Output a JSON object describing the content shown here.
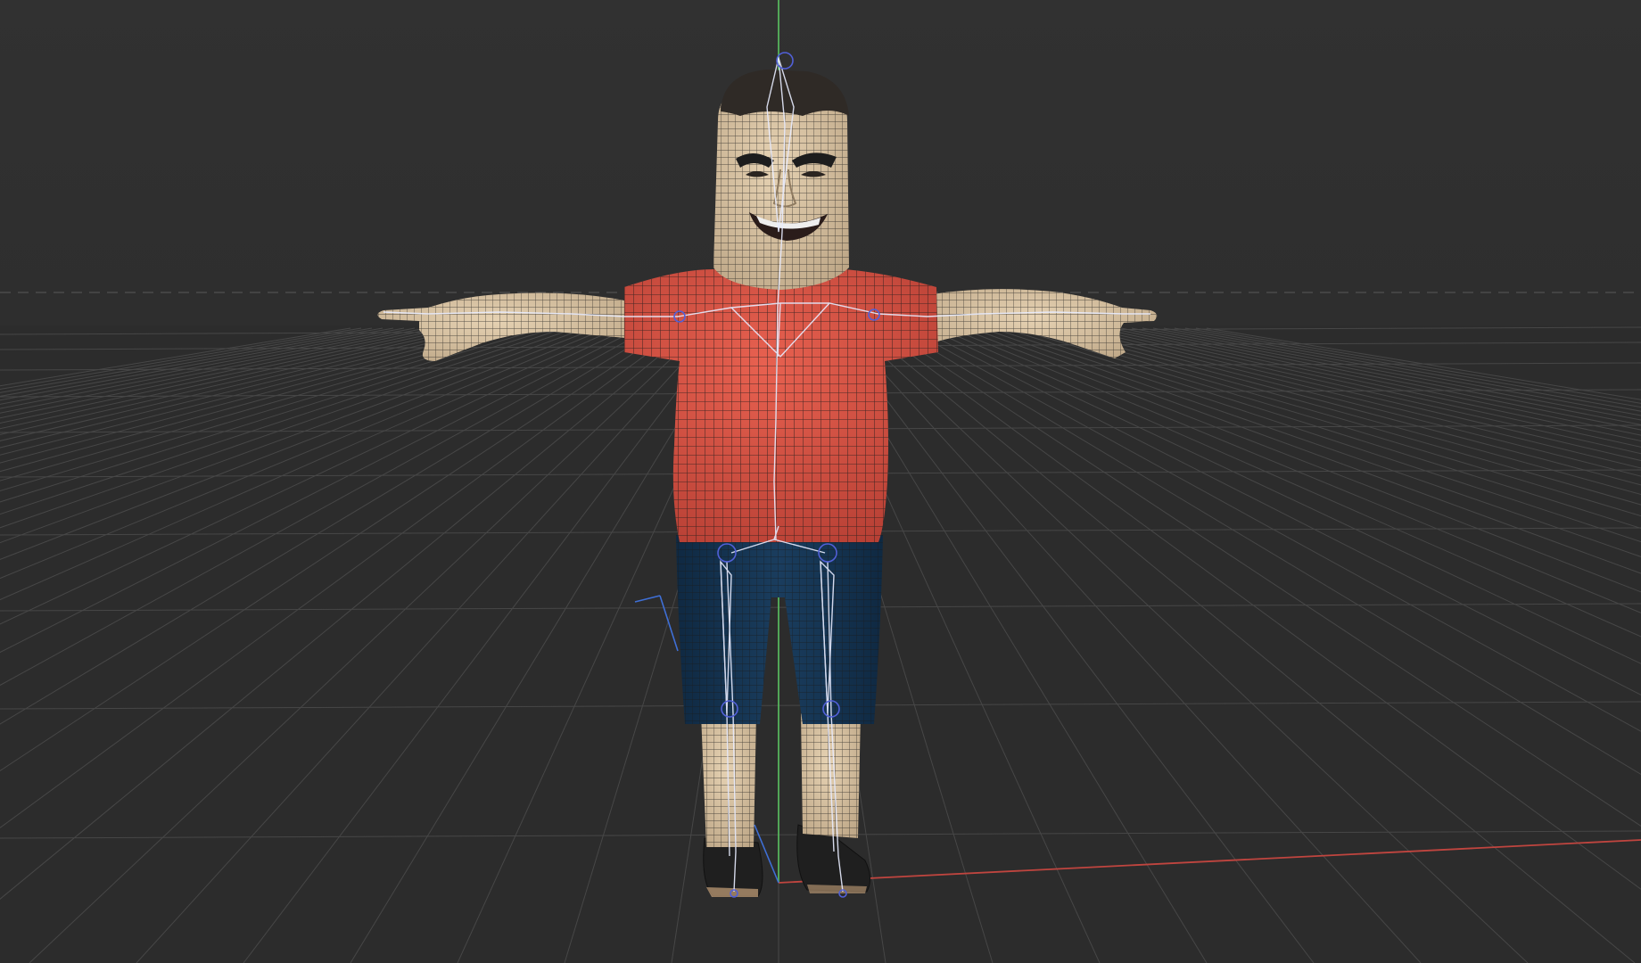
{
  "viewport": {
    "background": "#303030",
    "sky": "#323232",
    "floor": "#2a2a2a",
    "grid_color": "#474747",
    "show_grid": true,
    "show_wireframe": true,
    "show_armature": true
  },
  "axes": {
    "x_color": "#c0453f",
    "y_color": "#56b35c",
    "z_color": "#3f6fd6"
  },
  "character": {
    "pose": "T-pose",
    "skin_color": "#d9c3a2",
    "hair_color": "#2f2a26",
    "shirt_color": "#dd5040",
    "shorts_color": "#14314e",
    "shoe_color": "#1e1e1e",
    "wire_color": "#141414",
    "bone_color": "#e8ecff",
    "joint_color": "#5160d8"
  }
}
